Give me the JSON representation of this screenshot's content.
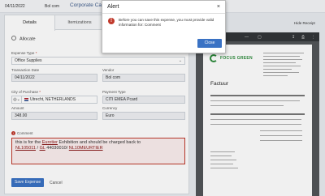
{
  "header": {
    "date": "04/11/2022",
    "merchant": "Bol com",
    "card_type": "Corporate Card"
  },
  "tabs": [
    {
      "label": "Details"
    },
    {
      "label": "Itemizations"
    }
  ],
  "form": {
    "allocate_label": "Allocate",
    "expense_type": {
      "label": "Expense Type",
      "value": "Office Supplies"
    },
    "transaction_date": {
      "label": "Transaction Date",
      "value": "04/11/2022"
    },
    "vendor": {
      "label": "Vendor",
      "value": "Bol com"
    },
    "city": {
      "label": "City of Purchase",
      "value": "Utrecht, NETHERLANDS"
    },
    "payment_type": {
      "label": "Payment Type",
      "value": "CITI EMEA Pcard"
    },
    "amount": {
      "label": "Amount",
      "value": "348.00"
    },
    "currency": {
      "label": "Currency",
      "value": "Euro"
    },
    "comment": {
      "label": "Comment",
      "text_before": "this is for the ",
      "link1": "Eurotier",
      "text_mid": " Exhibition and should be charged back to",
      "link2": "NL105011",
      "sep1": " / ",
      "link3": "GL",
      "mid2": " 44030010/ ",
      "link4": "NL10MEURTIER"
    },
    "save_label": "Save Expense",
    "cancel_label": "Cancel"
  },
  "receipt": {
    "hide_label": "Hide Receipt",
    "logo_text": "FOCUS GREEN",
    "doc_title": "Factuur"
  },
  "modal": {
    "title": "Alert",
    "close_glyph": "×",
    "message": "Before you can save this expense, you must provide valid information for: Comment",
    "button_label": "Close"
  },
  "colors": {
    "accent": "#3a72c4",
    "error": "#c0392b",
    "brand_green": "#2d8c3c"
  }
}
